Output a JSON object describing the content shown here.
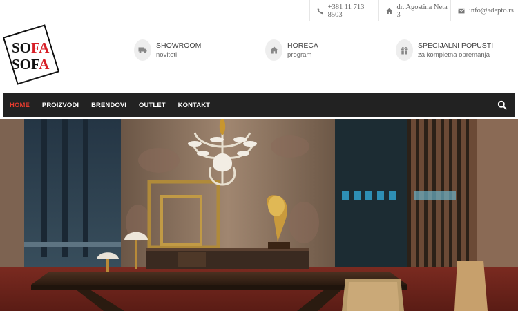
{
  "contact": {
    "phone": "+381 11 713 8503",
    "address": "dr. Agostina Neta 3",
    "email": "info@adepto.rs",
    "phone_icon": "phone-icon",
    "address_icon": "map-pin-icon",
    "email_icon": "envelope-icon"
  },
  "logo": {
    "line1_black": "SO",
    "line1_red": "FA",
    "line2_black": "SOF",
    "line2_red": "A"
  },
  "features": [
    {
      "title": "SHOWROOM",
      "subtitle": "noviteti",
      "icon": "truck-icon"
    },
    {
      "title": "HORECA",
      "subtitle": "program",
      "icon": "home-icon"
    },
    {
      "title": "SPECIJALNI POPUSTI",
      "subtitle": "za kompletna opremanja",
      "icon": "gift-icon"
    }
  ],
  "nav": {
    "items": [
      "HOME",
      "PROIZVODI",
      "BRENDOVI",
      "OUTLET",
      "KONTAKT"
    ],
    "active": "HOME",
    "search_icon": "search-icon"
  },
  "colors": {
    "accent": "#e63b2e",
    "nav_bg": "#222222",
    "logo_red": "#d71f27"
  }
}
